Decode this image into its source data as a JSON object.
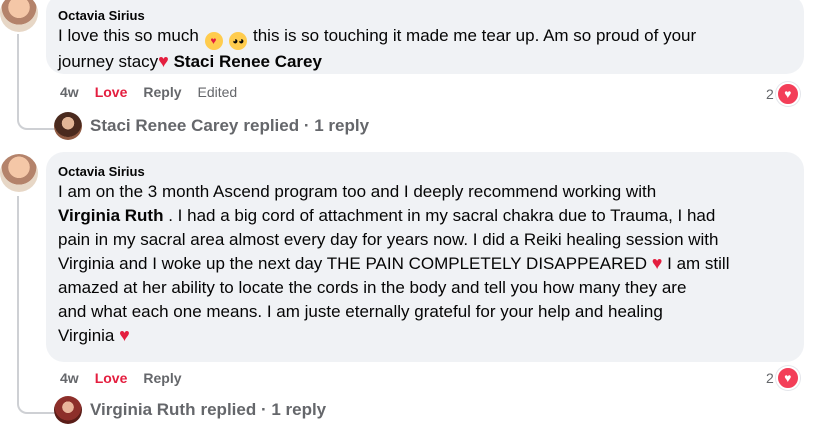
{
  "comments": [
    {
      "author": "Octavia Sirius",
      "text_part1": "I love this so much",
      "text_part2": "this is so touching it made me tear up. Am so proud of your",
      "text_part3": "journey stacy",
      "mention": "Staci Renee Carey",
      "meta": {
        "time": "4w",
        "love": "Love",
        "reply": "Reply",
        "edited": "Edited"
      },
      "reaction_count": "2",
      "replies_summary": {
        "name": "Staci Renee Carey",
        "label": "replied · 1 reply"
      }
    },
    {
      "author": "Octavia Sirius",
      "lines": [
        "I am on the 3 month Ascend program too and I deeply recommend working with",
        "Virginia Ruth",
        ". I had a big cord of attachment in my sacral chakra due to Trauma, I had",
        "pain in my sacral area almost every day for years now. I did a Reiki healing session with",
        "Virginia and I woke up the next day THE PAIN COMPLETELY DISAPPEARED",
        "I am still",
        "amazed at her ability to locate the cords in the body and tell you how many they are",
        "and what each one means. I am juste eternally grateful for your help and healing",
        "Virginia"
      ],
      "meta": {
        "time": "4w",
        "love": "Love",
        "reply": "Reply"
      },
      "reaction_count": "2",
      "replies_summary": {
        "name": "Virginia Ruth",
        "label": "replied · 1 reply"
      }
    }
  ],
  "icons": {
    "heart": "heart-icon",
    "love_face": "smiling-face-with-hearts-icon",
    "tear_face": "pleading-face-icon"
  },
  "colors": {
    "bubble": "#f0f2f5",
    "love": "#e41e3f",
    "muted": "#65676b"
  }
}
